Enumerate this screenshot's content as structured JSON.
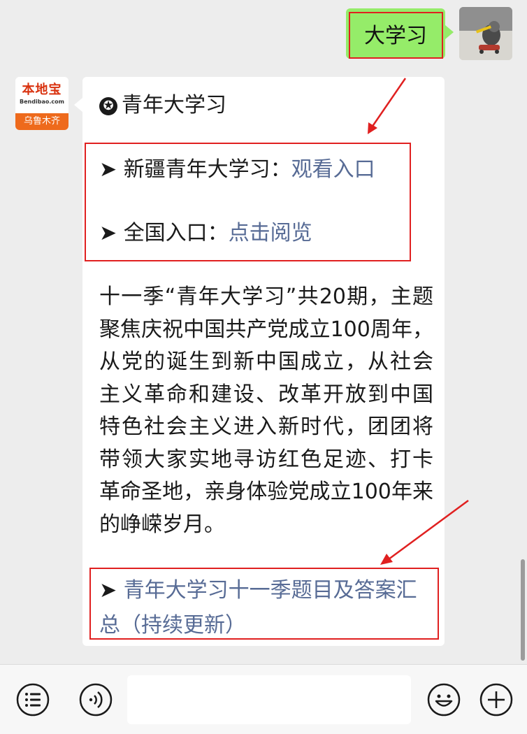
{
  "user_message": {
    "text": "大学习"
  },
  "bot": {
    "logo": {
      "name": "本地宝",
      "domain": "Bendibao.com",
      "city": "乌鲁木齐"
    },
    "header": {
      "icon": "✪",
      "title": "青年大学习"
    },
    "links": [
      {
        "arrow": "➤",
        "label": "新疆青年大学习：",
        "link_text": "观看入口"
      },
      {
        "arrow": "➤",
        "label": "全国入口：",
        "link_text": "点击阅览"
      }
    ],
    "paragraph": "十一季“青年大学习”共20期，主题聚焦庆祝中国共产党成立100周年，从党的诞生到新中国成立，从社会主义革命和建设、改革开放到中国特色社会主义进入新时代，团团将带领大家实地寻访红色足迹、打卡革命圣地，亲身体验党成立100年来的峥嵘岁月。",
    "final_link": {
      "arrow": "➤",
      "text": "青年大学习十一季题目及答案汇总（持续更新）"
    }
  },
  "toolbar": {
    "menu_icon": "menu-list-icon",
    "voice_icon": "voice-icon",
    "input_value": "",
    "emoji_icon": "emoji-icon",
    "add_icon": "add-icon"
  },
  "colors": {
    "bubble_green": "#95ec69",
    "link": "#576b95",
    "highlight_red": "#e02020",
    "background": "#ededed"
  }
}
